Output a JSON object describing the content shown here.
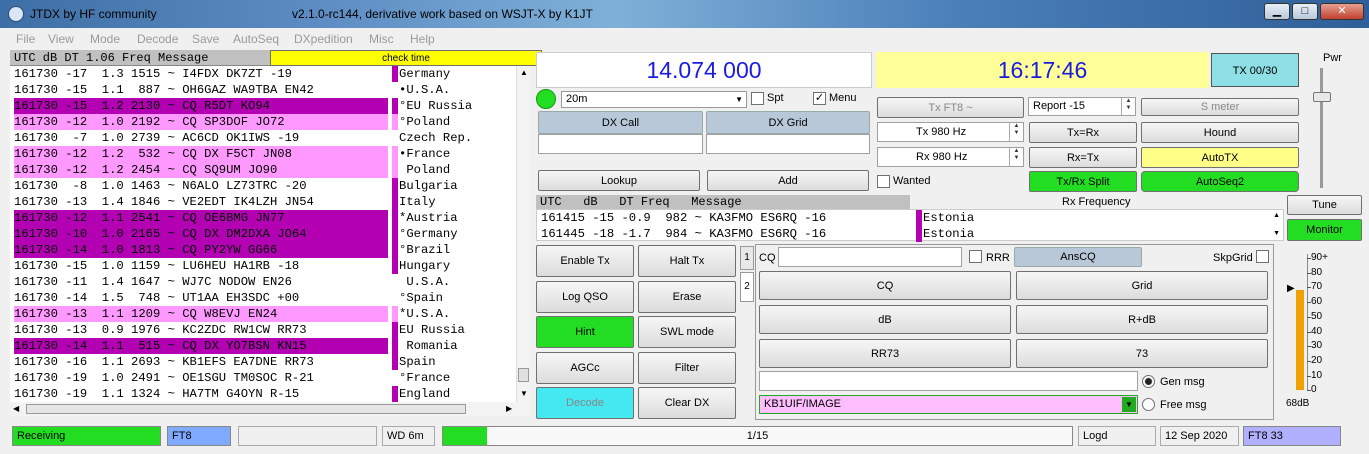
{
  "window": {
    "title": "JTDX  by HF community",
    "subtitle": "v2.1.0-rc144, derivative work based on WSJT-X by K1JT",
    "min": "▁",
    "max": "□",
    "close": "✕"
  },
  "menu": [
    "File",
    "View",
    "Mode",
    "Decode",
    "Save",
    "AutoSeq",
    "DXpedition",
    "Misc",
    "Help"
  ],
  "band": {
    "header": "UTC  dB  DT 1.06 Freq   Message",
    "check": "check time",
    "rows": [
      {
        "m": "161730 -17  1.3 1515 ~ I4FDX DK7ZT -19",
        "c": "Germany",
        "bg": "#ffffff",
        "bar": "#b300b3"
      },
      {
        "m": "161730 -15  1.1  887 ~ OH6GAZ WA9TBA EN42",
        "c": "•U.S.A.",
        "bg": "#ffffff",
        "bar": ""
      },
      {
        "m": "161730 -15  1.2 2130 ~ CQ R5DT KO94",
        "c": "°EU Russia",
        "bg": "#b300b3",
        "bar": ""
      },
      {
        "m": "161730 -12  1.0 2192 ~ CQ SP3DOF JO72",
        "c": "°Poland",
        "bg": "#ff99ff",
        "bar": ""
      },
      {
        "m": "161730  -7  1.0 2739 ~ AC6CD OK1IWS -19",
        "c": "Czech Rep.",
        "bg": "#ffffff",
        "bar": ""
      },
      {
        "m": "161730 -12  1.2  532 ~ CQ DX F5CT JN08",
        "c": "•France",
        "bg": "#ff99ff",
        "bar": ""
      },
      {
        "m": "161730 -12  1.2 2454 ~ CQ SQ9UM JO90",
        "c": " Poland",
        "bg": "#ff99ff",
        "bar": ""
      },
      {
        "m": "161730  -8  1.0 1463 ~ N6ALO LZ73TRC -20",
        "c": "Bulgaria",
        "bg": "#ffffff",
        "bar": "#b300b3"
      },
      {
        "m": "161730 -13  1.4 1846 ~ VE2EDT IK4LZH JN54",
        "c": "Italy",
        "bg": "#ffffff",
        "bar": "#b300b3"
      },
      {
        "m": "161730 -12  1.1 2541 ~ CQ OE6BMG JN77",
        "c": "*Austria",
        "bg": "#b300b3",
        "bar": ""
      },
      {
        "m": "161730 -10  1.0 2165 ~ CQ DX DM2DXA JO64",
        "c": "°Germany",
        "bg": "#b300b3",
        "bar": ""
      },
      {
        "m": "161730 -14  1.0 1813 ~ CQ PY2YW GG66",
        "c": "°Brazil",
        "bg": "#b300b3",
        "bar": ""
      },
      {
        "m": "161730 -15  1.0 1159 ~ LU6HEU HA1RB -18",
        "c": "Hungary",
        "bg": "#ffffff",
        "bar": "#b300b3"
      },
      {
        "m": "161730 -11  1.4 1647 ~ WJ7C NODOW EN26",
        "c": " U.S.A.",
        "bg": "#ffffff",
        "bar": ""
      },
      {
        "m": "161730 -14  1.5  748 ~ UT1AA EH3SDC +00",
        "c": "°Spain",
        "bg": "#ffffff",
        "bar": ""
      },
      {
        "m": "161730 -13  1.1 1209 ~ CQ W8EVJ EN24",
        "c": "*U.S.A.",
        "bg": "#ff99ff",
        "bar": ""
      },
      {
        "m": "161730 -13  0.9 1976 ~ KC2ZDC RW1CW RR73",
        "c": "EU Russia",
        "bg": "#ffffff",
        "bar": "#b300b3"
      },
      {
        "m": "161730 -14  1.1  515 ~ CQ DX YO7BSN KN15",
        "c": " Romania",
        "bg": "#b300b3",
        "bar": ""
      },
      {
        "m": "161730 -16  1.1 2693 ~ KB1EFS EA7DNE RR73",
        "c": "Spain",
        "bg": "#ffffff",
        "bar": "#b300b3"
      },
      {
        "m": "161730 -19  1.0 2491 ~ OE1SGU TM0SOC R-21",
        "c": "°France",
        "bg": "#ffffff",
        "bar": ""
      },
      {
        "m": "161730 -19  1.1 1324 ~ HA7TM G4OYN R-15",
        "c": "England",
        "bg": "#ffffff",
        "bar": "#b300b3"
      }
    ]
  },
  "freq": "14.074 000",
  "clock": "16:17:46",
  "tx_count": "TX 00/30",
  "band_sel": "20m",
  "spt": "Spt",
  "menu_chk": "Menu",
  "dxcall": "DX Call",
  "dxgrid": "DX Grid",
  "lookup": "Lookup",
  "add": "Add",
  "txft8": "Tx FT8 ~",
  "report": "Report -15",
  "smeter": "S meter",
  "tx_hz": "Tx  980  Hz",
  "rx_hz": "Rx  980  Hz",
  "txeqrx": "Tx=Rx",
  "rxeqtx": "Rx=Tx",
  "hound": "Hound",
  "autotx": "AutoTX",
  "wanted": "Wanted",
  "split": "Tx/Rx Split",
  "autoseq2": "AutoSeq2",
  "rxfreq_label": "Rx Frequency",
  "tune": "Tune",
  "monitor": "Monitor",
  "pwr": "Pwr",
  "rx": {
    "header": "UTC   dB   DT Freq   Message",
    "rows": [
      {
        "m": "161415 -15 -0.9  982 ~ KA3FMO ES6RQ -16",
        "c": "Estonia"
      },
      {
        "m": "161445 -18 -1.7  984 ~ KA3FMO ES6RQ -16",
        "c": "Estonia"
      }
    ]
  },
  "btns": {
    "enable": "Enable Tx",
    "halt": "Halt Tx",
    "logqso": "Log QSO",
    "erase": "Erase",
    "hint": "Hint",
    "swl": "SWL mode",
    "agcc": "AGCc",
    "filter": "Filter",
    "decode": "Decode",
    "cleardx": "Clear DX"
  },
  "tabs": [
    "1",
    "2"
  ],
  "cq_lbl": "CQ",
  "rrr": "RRR",
  "anscq": "AnsCQ",
  "skpgrid": "SkpGrid",
  "gen": {
    "cq": "CQ",
    "grid": "Grid",
    "db": "dB",
    "rdb": "R+dB",
    "rr73": "RR73",
    "s73": "73"
  },
  "genmsg": "Gen msg",
  "freemsg": "Free msg",
  "freetext": "KB1UIF/IMAGE",
  "meter": {
    "ticks": [
      "90+",
      "80",
      "70",
      "60",
      "50",
      "40",
      "30",
      "20",
      "10",
      "0"
    ],
    "db": "68dB",
    "level_db": 68
  },
  "status": {
    "receiving": "Receiving",
    "mode": "FT8",
    "wd": "WD 6m",
    "progress": "1/15",
    "progress_frac": 0.07,
    "logd": "Logd",
    "date": "12 Sep 2020",
    "ft8n": "FT8  33"
  }
}
